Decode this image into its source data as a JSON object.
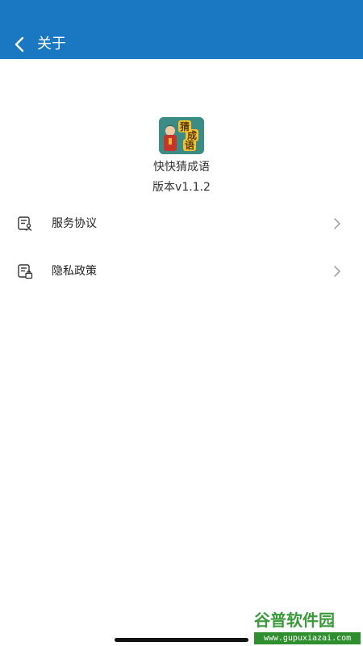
{
  "header": {
    "back_icon": "chevron-left-icon",
    "title": "关于"
  },
  "app": {
    "icon_name": "app-logo-icon",
    "icon_text": "猜成语",
    "name": "快快猜成语",
    "version": "版本v1.1.2"
  },
  "menu": {
    "items": [
      {
        "label": "服务协议",
        "icon": "document-user-icon"
      },
      {
        "label": "隐私政策",
        "icon": "document-lock-icon"
      }
    ]
  },
  "watermark": {
    "title": "谷普软件园",
    "url": "www.gupuxiazai.com"
  },
  "colors": {
    "header_bg": "#1a78c2",
    "text": "#222222",
    "watermark_green": "#3a9a3a"
  }
}
